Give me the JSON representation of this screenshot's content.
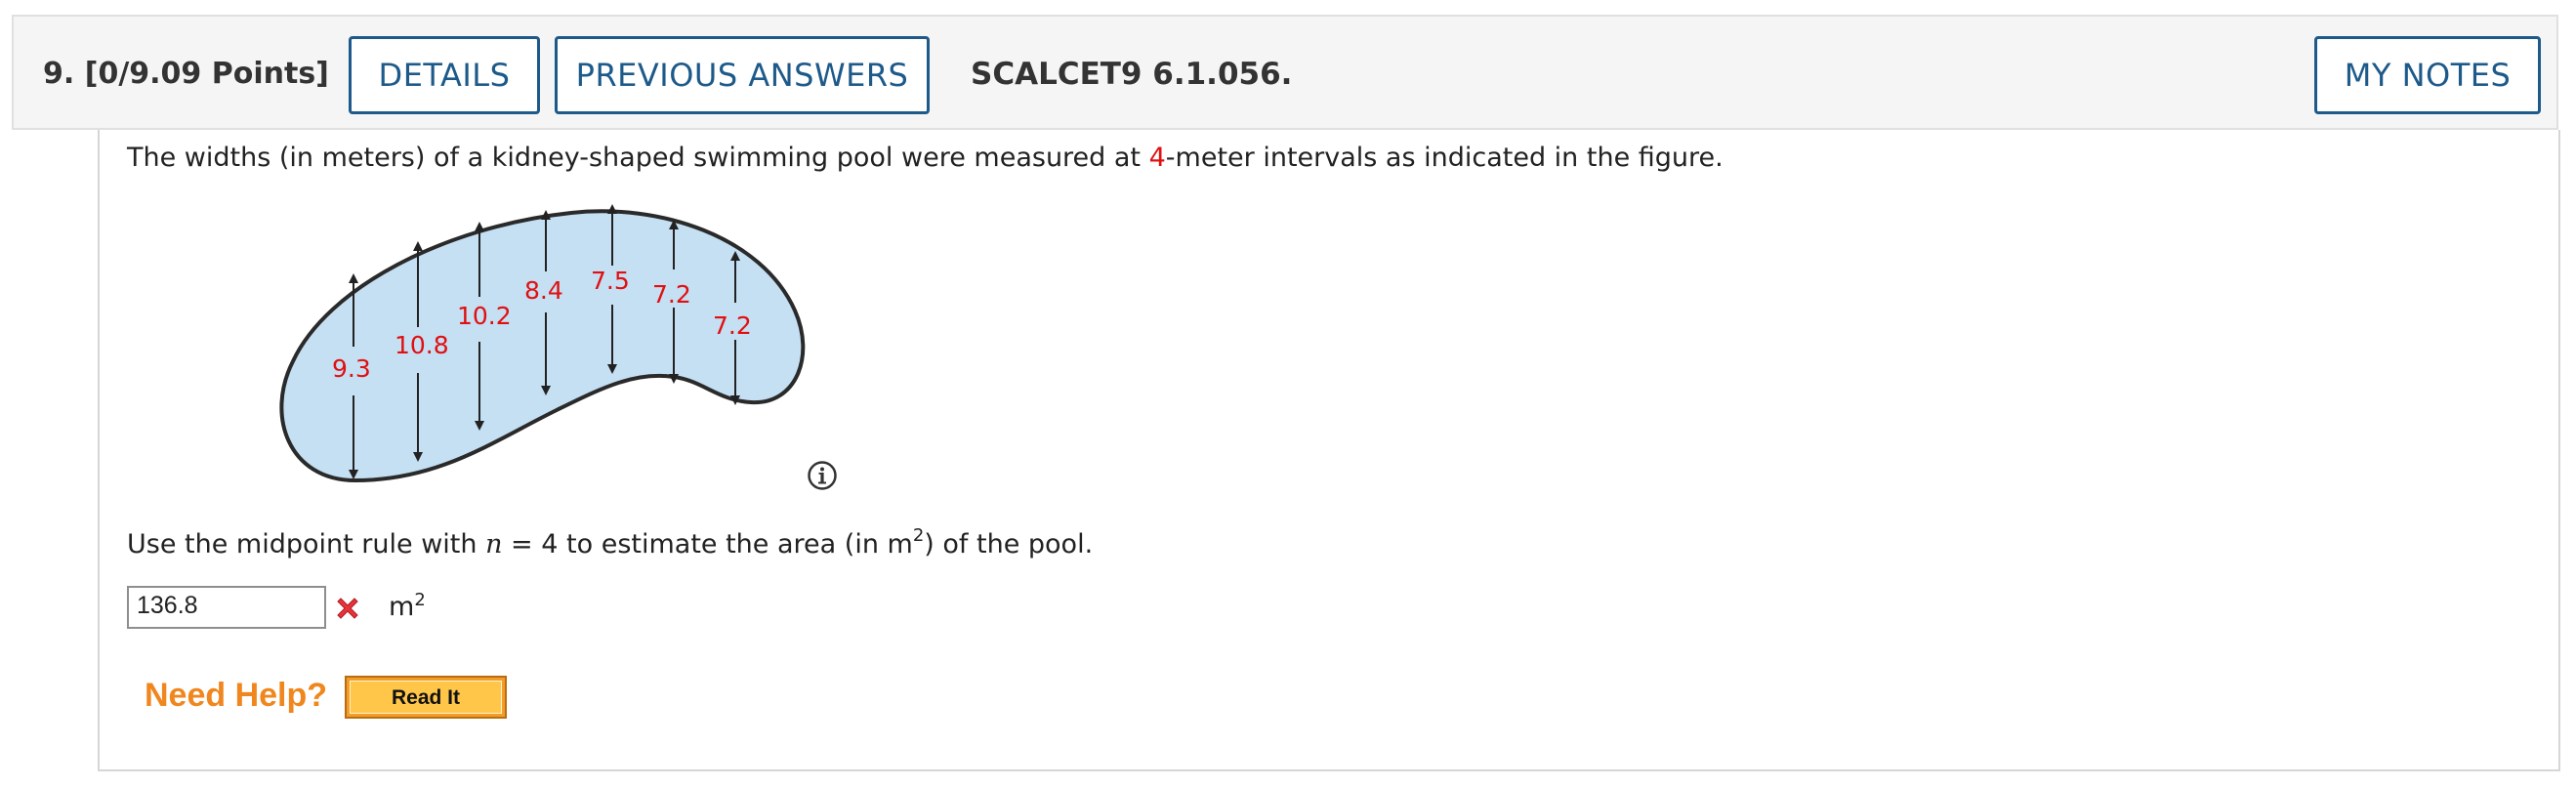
{
  "header": {
    "question_number": "9.",
    "points": "[0/9.09 Points]",
    "details_label": "DETAILS",
    "previous_answers_label": "PREVIOUS ANSWERS",
    "question_code": "SCALCET9 6.1.056.",
    "my_notes_label": "MY NOTES"
  },
  "problem": {
    "intro_before": "The widths (in meters) of a kidney-shaped swimming pool were measured at ",
    "intro_interval": "4",
    "intro_after": "-meter intervals as indicated in the figure.",
    "figure_widths": [
      "9.3",
      "10.8",
      "10.2",
      "8.4",
      "7.5",
      "7.2",
      "7.2"
    ],
    "prompt_before": "Use the midpoint rule with ",
    "prompt_var": "n",
    "prompt_mid": " = 4 to estimate the area (in m",
    "prompt_exp": "2",
    "prompt_after": ") of the pool."
  },
  "answer": {
    "value": "136.8",
    "status": "incorrect",
    "unit_base": "m",
    "unit_exp": "2"
  },
  "help": {
    "need_help_label": "Need Help?",
    "read_it_label": "Read It"
  },
  "colors": {
    "accent_blue": "#1d5a8a",
    "error_red": "#e01010",
    "pool_fill": "#c5dff3",
    "help_orange": "#f0871e"
  },
  "icons": {
    "info": "info-circle-icon",
    "wrong": "red-x-icon"
  }
}
